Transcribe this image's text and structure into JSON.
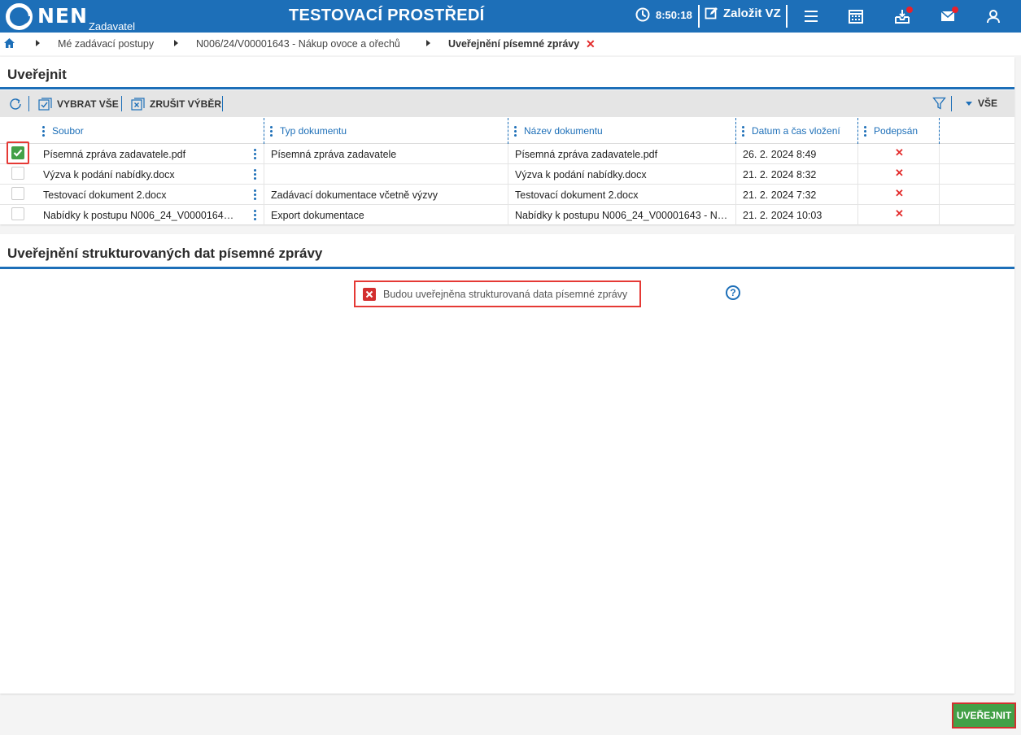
{
  "header": {
    "logo_text": "NEN",
    "logo_subtitle": "Zadavatel",
    "environment_title": "TESTOVACÍ PROSTŘEDÍ",
    "time": "8:50:18",
    "create_label": "Založit VZ"
  },
  "breadcrumb": {
    "items": [
      "Mé zadávací postupy",
      "N006/24/V00001643 - Nákup ovoce a ořechů"
    ],
    "current": "Uveřejnění písemné zprávy"
  },
  "publish_section": {
    "title": "Uveřejnit",
    "toolbar": {
      "select_all": "VYBRAT VŠE",
      "deselect": "ZRUŠIT VÝBĚR",
      "filter_value": "VŠE"
    },
    "columns": [
      "Soubor",
      "Typ dokumentu",
      "Název dokumentu",
      "Datum a čas vložení",
      "Podepsán"
    ],
    "rows": [
      {
        "file": "Písemná zpráva zadavatele.pdf",
        "type": "Písemná zpráva zadavatele",
        "name": "Písemná zpráva zadavatele.pdf",
        "datetime": "26. 2. 2024 8:49",
        "signed": "no",
        "checked": true
      },
      {
        "file": "Výzva k podání nabídky.docx",
        "type": "",
        "name": "Výzva k podání nabídky.docx",
        "datetime": "21. 2. 2024 8:32",
        "signed": "no",
        "checked": false
      },
      {
        "file": "Testovací dokument 2.docx",
        "type": "Zadávací dokumentace včetně výzvy",
        "name": "Testovací dokument 2.docx",
        "datetime": "21. 2. 2024 7:32",
        "signed": "no",
        "checked": false
      },
      {
        "file": "Nabídky k postupu N006_24_V0000164…",
        "type": "Export dokumentace",
        "name": "Nabídky k postupu N006_24_V00001643 - N…",
        "datetime": "21. 2. 2024 10:03",
        "signed": "no",
        "checked": false
      }
    ]
  },
  "structured_section": {
    "title": "Uveřejnění strukturovaných dat písemné zprávy",
    "checkbox_label": "Budou uveřejněna strukturovaná data písemné zprávy",
    "checkbox_checked": false
  },
  "publish_button": "UVEŘEJNIT",
  "colors": {
    "primary": "#1d6fb8",
    "success": "#43a047",
    "danger": "#e32b2b"
  }
}
